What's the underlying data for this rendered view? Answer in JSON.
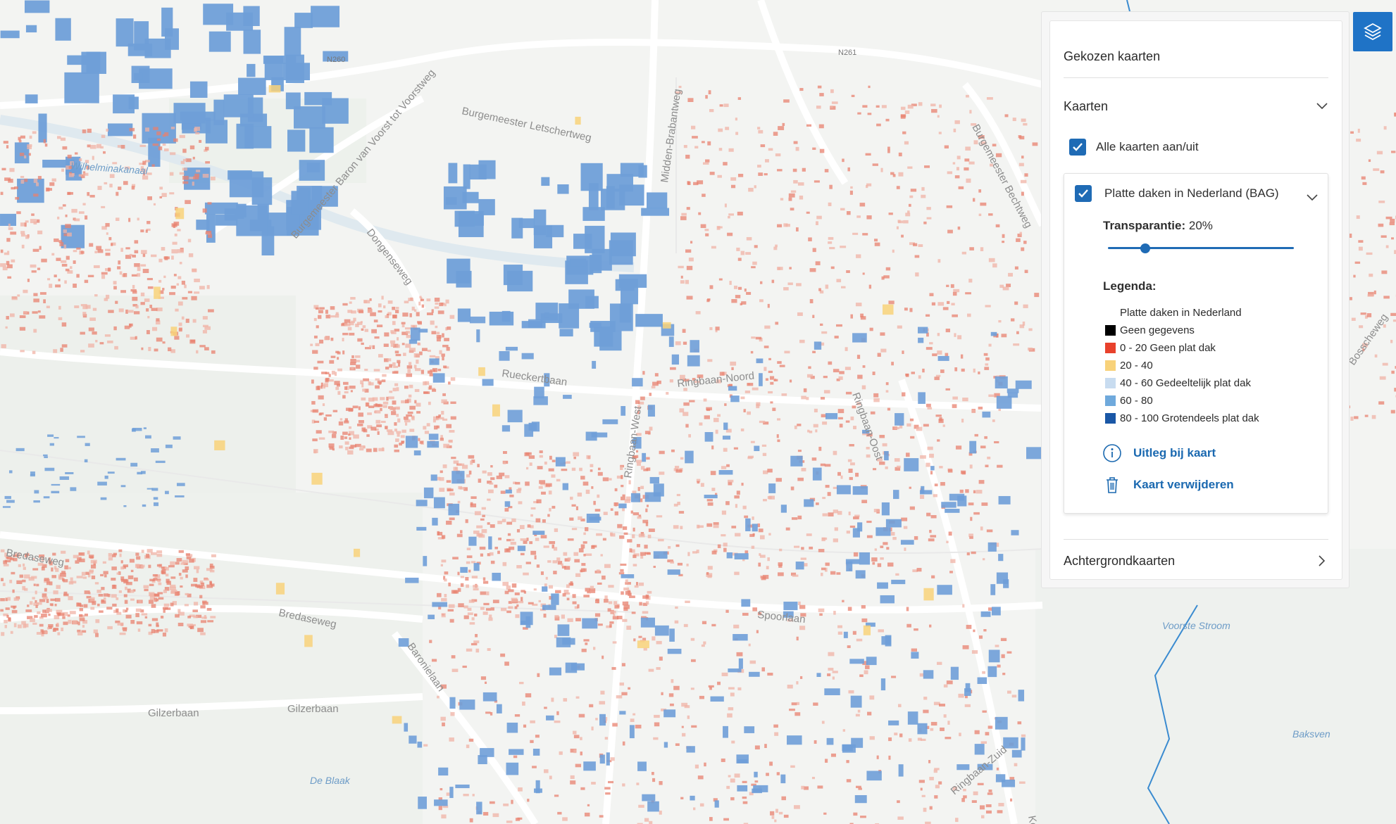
{
  "panel": {
    "title": "Gekozen kaarten",
    "maps_section": "Kaarten",
    "all_maps_toggle": "Alle kaarten aan/uit",
    "layer": {
      "name": "Platte daken in Nederland (BAG)",
      "transparency_label": "Transparantie:",
      "transparency_value": "20%",
      "transparency_fraction": 0.2,
      "legend_title": "Legenda:",
      "legend_header": "Platte daken in Nederland",
      "legend_items": [
        {
          "label": "Geen gegevens",
          "color": "#000000"
        },
        {
          "label": "0 - 20 Geen plat dak",
          "color": "#e8412c"
        },
        {
          "label": "20 - 40",
          "color": "#f8d27a"
        },
        {
          "label": "40 - 60 Gedeeltelijk plat dak",
          "color": "#c8dcf0"
        },
        {
          "label": "60 - 80",
          "color": "#6fa9dc"
        },
        {
          "label": "80 - 100 Grotendeels plat dak",
          "color": "#1a57a6"
        }
      ],
      "info_link": "Uitleg bij kaart",
      "delete_link": "Kaart verwijderen"
    },
    "background_section": "Achtergrondkaarten"
  },
  "map": {
    "road_labels": [
      "N260",
      "N261",
      "Burgemeester Letschertweg",
      "Burgemeester Baron van Voorst tot Voorstweg",
      "Wilhelminakanaal",
      "Dongenseweg",
      "Midden-Brabantweg",
      "Burgemeester Bechtweg",
      "Rueckertbaan",
      "Ringbaan-Noord",
      "Ringbaan-West",
      "Ringbaan-Oost",
      "Bredaseweg",
      "Gilzerbaan",
      "Baronielaan",
      "Spoorlaan",
      "Ringbaan-Zuid",
      "Voorste Stroom",
      "Baksven",
      "De Blaak",
      "Bosscheweg",
      "Kempen"
    ]
  },
  "colors": {
    "accent": "#1f6bb5",
    "flat_roof_blue": "#6f9fd8",
    "red_roof": "#e8826f"
  }
}
